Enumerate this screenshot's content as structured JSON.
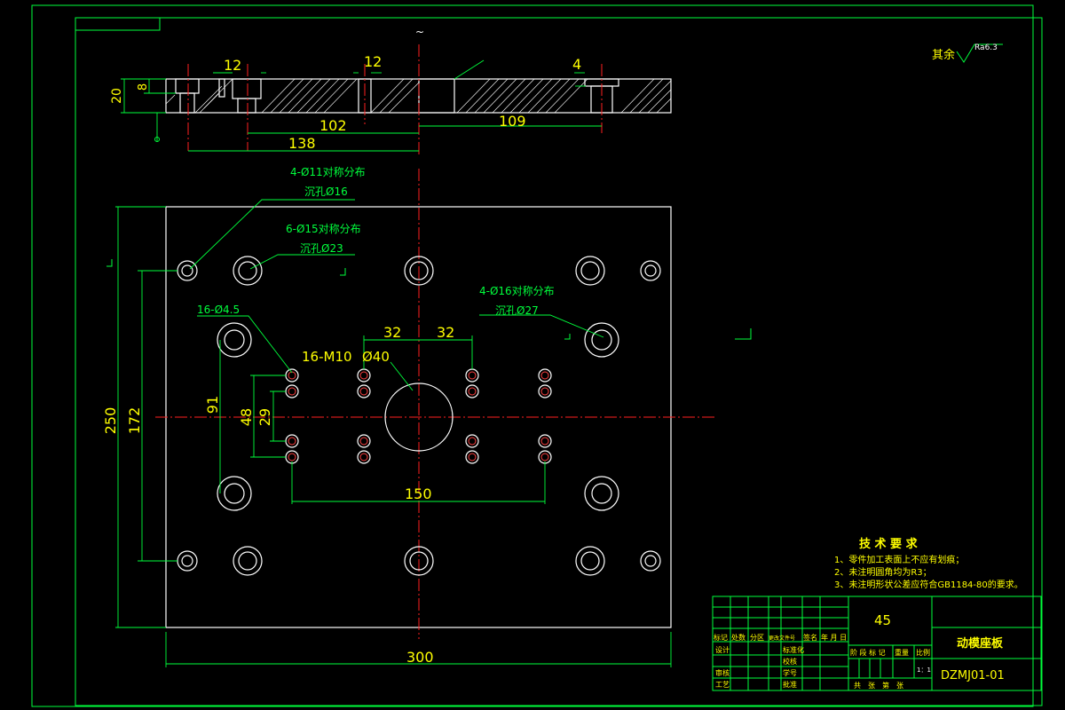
{
  "drawing": {
    "surface_note_prefix": "其余",
    "surface_note_roughness": "Ra6.3",
    "top_mark": "~"
  },
  "section_view": {
    "dims": {
      "thickness": "20",
      "counterbore_depth": "8",
      "hole_a": "12",
      "hole_b": "12",
      "hole_c": "4",
      "d102": "102",
      "d109": "109",
      "d138": "138"
    }
  },
  "plan_view": {
    "callouts": {
      "c1_line1": "4-Ø11对称分布",
      "c1_line2": "沉孔Ø16",
      "c2_line1": "6-Ø15对称分布",
      "c2_line2": "沉孔Ø23",
      "c3_line1": "4-Ø16对称分布",
      "c3_line2": "沉孔Ø27",
      "c4": "16-Ø4.5",
      "c5": "16-M10",
      "c6": "Ø40"
    },
    "dims": {
      "d32a": "32",
      "d32b": "32",
      "d250": "250",
      "d172": "172",
      "d91": "91",
      "d48": "48",
      "d29": "29",
      "d150": "150",
      "d300": "300"
    }
  },
  "tech_req": {
    "title": "技 术 要 求",
    "items": [
      "1、零件加工表面上不应有划痕；",
      "2、未注明圆角均为R3；",
      "3、未注明形状公差应符合GB1184-80的要求。"
    ]
  },
  "title_block": {
    "material": "45",
    "part_name": "动模座板",
    "drawing_no": "DZMJ01-01",
    "headers": [
      "标记",
      "处数",
      "分区",
      "更改文件号",
      "签名",
      "年 月 日"
    ],
    "row_design": "设计",
    "row_std": "标准化",
    "row_review": "审核",
    "row_process": "工艺",
    "col_check": "校核",
    "col_student": "学号",
    "col_approve": "批准",
    "stage_headers": [
      "阶 段 标 记",
      "重量",
      "比例"
    ],
    "scale": "1：1",
    "sheet_text": "共　张　第　张"
  }
}
